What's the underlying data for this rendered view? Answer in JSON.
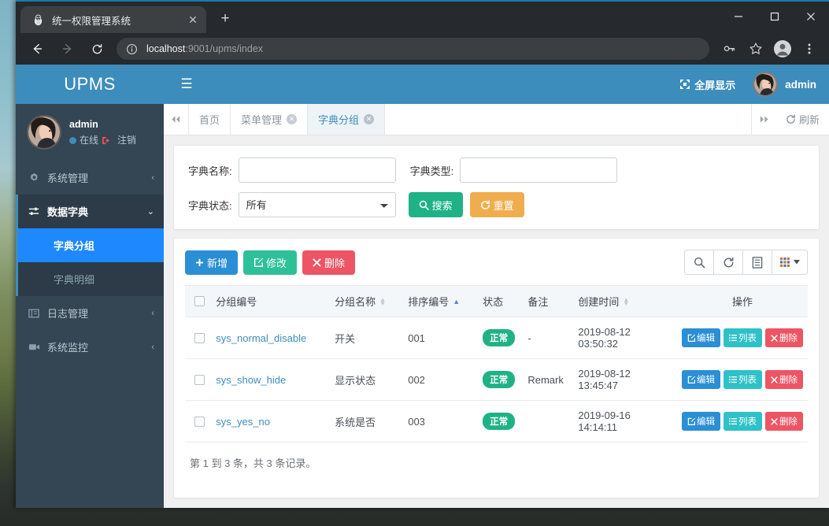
{
  "browser": {
    "tab_title": "统一权限管理系统",
    "tab_favicon": "penguin-icon",
    "new_tab_label": "+",
    "close_tab_label": "✕",
    "window_controls": {
      "minimize": "—",
      "maximize": "☐",
      "close": "✕"
    },
    "url_host": "localhost",
    "url_path": ":9001/upms/index",
    "toolbar_icons": [
      "back-icon",
      "forward-icon",
      "reload-icon",
      "site-info-icon",
      "key-icon",
      "star-icon",
      "profile-icon",
      "menu-icon"
    ]
  },
  "sidebar": {
    "brand": "UPMS",
    "user": {
      "name": "admin",
      "status": "在线",
      "logout": "注销"
    },
    "items": [
      {
        "label": "系统管理",
        "icon": "gear-icon",
        "arrow": "‹",
        "state": "collapsed"
      },
      {
        "label": "数据字典",
        "icon": "sliders-icon",
        "arrow": "⌄",
        "state": "open"
      },
      {
        "label": "日志管理",
        "icon": "book-icon",
        "arrow": "‹",
        "state": "collapsed"
      },
      {
        "label": "系统监控",
        "icon": "video-icon",
        "arrow": "‹",
        "state": "collapsed"
      }
    ],
    "submenu": [
      {
        "label": "字典分组",
        "active": true
      },
      {
        "label": "字典明细",
        "active": false
      }
    ]
  },
  "navbar": {
    "menu_toggle": "☰",
    "fullscreen_label": "全屏显示",
    "fullscreen_icon": "expand-icon",
    "username": "admin"
  },
  "tabbar": {
    "scroll_left": "◀◀",
    "scroll_right": "▶▶",
    "refresh_label": "刷新",
    "refresh_icon": "refresh-icon",
    "tabs": [
      {
        "label": "首页",
        "closable": false,
        "active": false
      },
      {
        "label": "菜单管理",
        "closable": true,
        "active": false
      },
      {
        "label": "字典分组",
        "closable": true,
        "active": true
      }
    ]
  },
  "search": {
    "name_label": "字典名称:",
    "name_value": "",
    "type_label": "字典类型:",
    "type_value": "",
    "status_label": "字典状态:",
    "status_value": "所有",
    "status_options": [
      "所有"
    ],
    "search_button": "搜索",
    "reset_button": "重置"
  },
  "toolbar": {
    "add_label": "新增",
    "edit_label": "修改",
    "delete_label": "删除",
    "icons": [
      "search-icon",
      "refresh-icon",
      "list-view-icon",
      "columns-icon"
    ]
  },
  "table": {
    "columns": [
      {
        "label": "",
        "sort": "none"
      },
      {
        "label": "分组编号",
        "sort": "none"
      },
      {
        "label": "分组名称",
        "sort": "both"
      },
      {
        "label": "排序编号",
        "sort": "asc"
      },
      {
        "label": "状态",
        "sort": "none"
      },
      {
        "label": "备注",
        "sort": "none"
      },
      {
        "label": "创建时间",
        "sort": "both"
      },
      {
        "label": "操作",
        "sort": "none"
      }
    ],
    "rows": [
      {
        "code": "sys_normal_disable",
        "name": "开关",
        "order": "001",
        "status": "正常",
        "remark": "-",
        "created": "2019-08-12 03:50:32"
      },
      {
        "code": "sys_show_hide",
        "name": "显示状态",
        "order": "002",
        "status": "正常",
        "remark": "Remark",
        "created": "2019-08-12 13:45:47"
      },
      {
        "code": "sys_yes_no",
        "name": "系统是否",
        "order": "003",
        "status": "正常",
        "remark": "",
        "created": "2019-09-16 14:14:11"
      }
    ],
    "row_actions": {
      "edit": "编辑",
      "list": "列表",
      "delete": "删除"
    },
    "footer": "第 1 到 3 条，共 3 条记录。"
  },
  "colors": {
    "brand_blue": "#3c8dbc",
    "sidebar_dark": "#344553",
    "sidebar_active": "#1e88ff",
    "teal": "#20b287",
    "orange": "#f0ad4e",
    "red": "#ed5565",
    "turquoise": "#2ec1c8",
    "blue_btn": "#2a8fd4"
  }
}
